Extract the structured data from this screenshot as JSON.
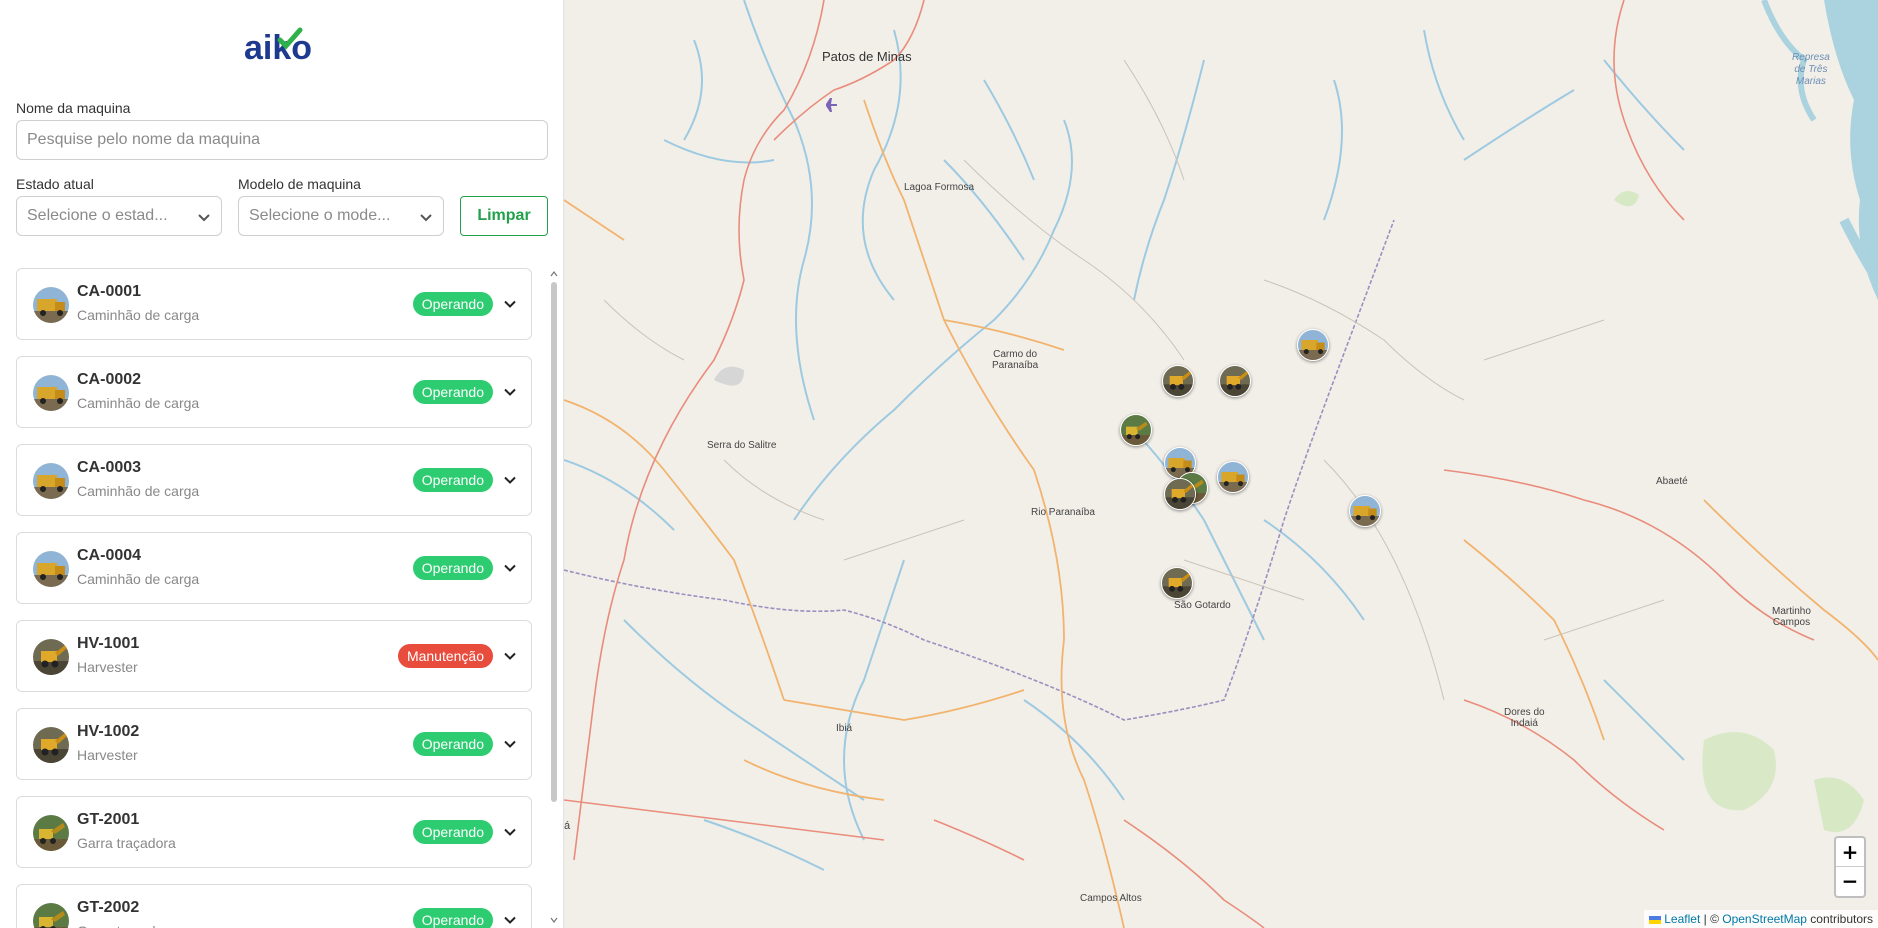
{
  "brand": {
    "logo_text": "aiko"
  },
  "filters": {
    "name_label": "Nome da maquina",
    "name_placeholder": "Pesquise pelo nome da maquina",
    "state_label": "Estado atual",
    "state_placeholder": "Selecione o estad...",
    "model_label": "Modelo de maquina",
    "model_placeholder": "Selecione o mode...",
    "clear_label": "Limpar"
  },
  "machines": [
    {
      "name": "CA-0001",
      "model": "Caminhão de carga",
      "status": "Operando",
      "kind": "truck"
    },
    {
      "name": "CA-0002",
      "model": "Caminhão de carga",
      "status": "Operando",
      "kind": "truck"
    },
    {
      "name": "CA-0003",
      "model": "Caminhão de carga",
      "status": "Operando",
      "kind": "truck"
    },
    {
      "name": "CA-0004",
      "model": "Caminhão de carga",
      "status": "Operando",
      "kind": "truck"
    },
    {
      "name": "HV-1001",
      "model": "Harvester",
      "status": "Manutenção",
      "kind": "harvester"
    },
    {
      "name": "HV-1002",
      "model": "Harvester",
      "status": "Operando",
      "kind": "harvester"
    },
    {
      "name": "GT-2001",
      "model": "Garra traçadora",
      "status": "Operando",
      "kind": "grapple"
    },
    {
      "name": "GT-2002",
      "model": "Garra traçadora",
      "status": "Operando",
      "kind": "grapple"
    }
  ],
  "status_colors": {
    "Operando": "#2ecc71",
    "Manutenção": "#e74c3c"
  },
  "map": {
    "places": {
      "patos": "Patos de Minas",
      "lagoa": "Lagoa Formosa",
      "carmo_1": "Carmo do",
      "carmo_2": "Paranaíba",
      "serra": "Serra do Salitre",
      "rio": "Rio Paranaíba",
      "sao_gotardo": "São Gotardo",
      "abaete": "Abaeté",
      "martinho_1": "Martinho",
      "martinho_2": "Campos",
      "dores_1": "Dores do",
      "dores_2": "Indaiá",
      "ibia": "Ibiá",
      "campos_altos": "Campos Altos",
      "represa_1": "Represa",
      "represa_2": "de Três",
      "represa_3": "Marias",
      "edge_a": "á"
    },
    "zoom_in": "+",
    "zoom_out": "−",
    "attribution": {
      "leaflet": "Leaflet",
      "sep": " | © ",
      "osm": "OpenStreetMap",
      "suffix": " contributors"
    }
  }
}
